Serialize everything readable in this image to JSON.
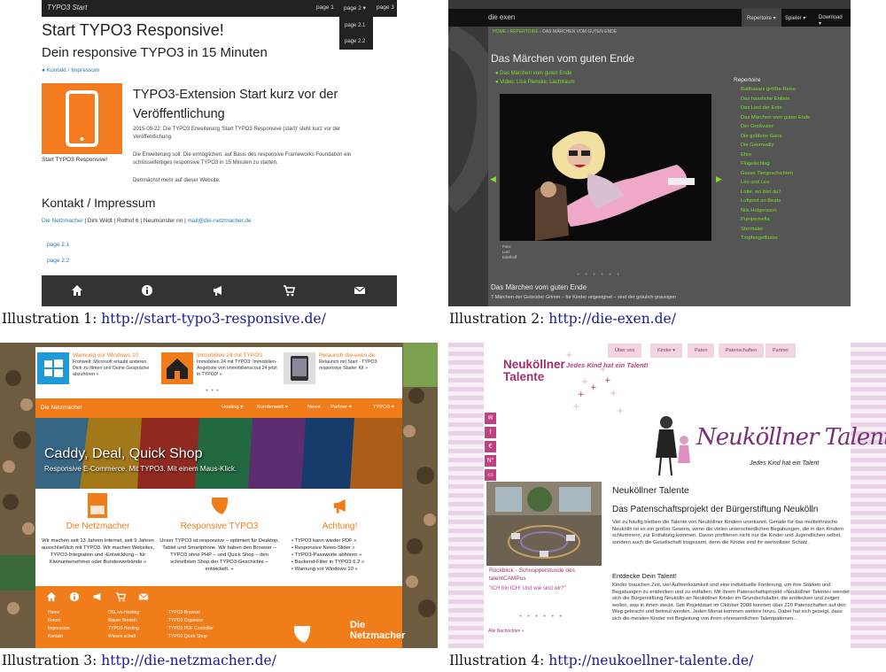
{
  "captions": [
    {
      "label": "Illustration 1: ",
      "url": "http://start-typo3-responsive.de/"
    },
    {
      "label": "Illustration 2: ",
      "url": "http://die-exen.de/"
    },
    {
      "label": "Illustration 3: ",
      "url": "http://die-netzmacher.de/"
    },
    {
      "label": "Illustration 4: ",
      "url": "http://neukoellner-talente.de/"
    }
  ],
  "site1": {
    "brand": "TYPO3 Start",
    "nav": [
      "page 1",
      "page 2 ▾",
      "page 3"
    ],
    "dropdown": [
      "page 2.1",
      "page 2.2"
    ],
    "title": "Start TYPO3 Responsive!",
    "subtitle": "Dein responsive TYPO3 in 15 Minuten",
    "link_contact": "● Kontakt / Impressum",
    "logo_caption": "Start TYPO3 Responsive!",
    "news_title": "TYPO3-Extension Start kurz vor der Veröffentlichung",
    "news_p1": "2015-09-22: Die TYPO3 Erweiterung 'Start TYPO3 Responsive (start)' steht kurz vor der Veröffentlichung.",
    "news_p2": "Die Erweiterung soll: Die ermöglichen, auf Basis des responsive Frameworks Foundation ein schlüsselfertiges responsive TYPO3 in 15 Minuten zu starten.",
    "news_p3": "Demnächst mehr auf dieser Website.",
    "contact_title": "Kontakt / Impressum",
    "contact_link1": "Die Netzmacher",
    "contact_text": " | Dirk Wildt | Rothof 6 | Neumünster nn | ",
    "contact_link2": "mail@die-netzmacher.de",
    "sublinks": [
      "page 2.1",
      "page 2.2"
    ],
    "footer_icons": [
      "home-icon",
      "info-icon",
      "megaphone-icon",
      "cart-icon",
      "mail-icon"
    ]
  },
  "site2": {
    "brand": "die exen",
    "menu": [
      "Repertoire ▾",
      "Spieler ▾",
      "Download ▾"
    ],
    "bread_home": "HOME",
    "bread_mid": "REPERTOIRE",
    "bread_current": "DAS MÄRCHEN VOM GUTEN ENDE",
    "title": "Das Märchen vom guten Ende",
    "links": [
      "● Das Märchen vom guten Ende",
      "● Video: Lisa Plenske, Lachtraum"
    ],
    "credit": [
      "Foto:",
      "Lutz",
      "Edelhoff"
    ],
    "sub_title": "Das Märchen vom guten Ende",
    "sub_text": "7 Märchen der Gebrüder Grimm – für Kinder ungeeignet – sind der gräulich grausigen",
    "repertoire_title": "Repertoire",
    "repertoire": [
      "Balthasars größte Reise",
      "Das hässliche Entlein",
      "Das Lied der Erde",
      "Das Märchen vom guten Ende",
      "Der Großvater",
      "Die goldene Gans",
      "Die Geierwally",
      "Ehre",
      "Flügelschlag",
      "Gasse Tiergeschichten",
      "Leo und Lea",
      "Lotte, wo bist du?",
      "Luftpost an Beate",
      "Nils Holgersson",
      "Pumpernella",
      "Sterntaler",
      "Tropfengeflüster"
    ]
  },
  "site3": {
    "teasers": [
      {
        "title": "Warnung vor Windows 10",
        "text": "Frohwelt: Microsoft erlaubt anderen, Dich zu filmen und Deine Gespräche abzuhören »"
      },
      {
        "title": "Immobilien 24 mit TYPO3",
        "text": "Immobilien 24 mit TYPO3: Immobilien-Angebote von immobilienscout 24 jetzt in TYPO3! »"
      },
      {
        "title": "Relaunch die-exen.de",
        "text": "Relaunch mit Start - TYPO3 responsive Starter Kit »"
      }
    ],
    "brand": "Die Netzmacher",
    "nav": [
      "Hosting ▾",
      "Kundenwelt ▾",
      "News",
      "Partner ▾",
      "TYPO3 ▾"
    ],
    "hero_title": "Caddy, Deal, Quick Shop",
    "hero_sub": "Responsive E-Commerce. Mit TYPO3. Mit einem Maus-Klick.",
    "columns": [
      {
        "title": "Die Netzmacher",
        "icon": "netzmacher-logo-icon",
        "text": "Wir machen seit 13 Jahren Internet, seit 9 Jahren ausschließlich mit TYPO3. Wir machen Websites, TYPO3-Integration und -Entwicklung – für Kleinunternehmer oder Bundesverbände »"
      },
      {
        "title": "Responsive TYPO3",
        "icon": "typo3-logo-icon",
        "text": "Unser TYPO3 ist responsive – optimiert für Desktop, Tablet und Smartphone. Wir haben den Browser – TYPO3 ohne PHP – und Quick Shop – den schnellsten Shop der TYPO3-Geschichte – entwickelt. »"
      },
      {
        "title": "Achtung!",
        "icon": "megaphone-icon",
        "list": [
          "• TYPO3 kann wieder PDF »",
          "• Responsive News-Slider »",
          "• TYPO3-Passworte abhören »",
          "• Backend-Filter in TYPO3 6.2 »",
          "• Warnung vor Windows 10 »"
        ]
      }
    ],
    "footer_links": [
      [
        "Home",
        "Forum",
        "Impressum",
        "Kontakt"
      ],
      [
        "DSL-vs-Hosting",
        "Blauer Bereich",
        "TYPO3 Hosting",
        "Wissen schaft"
      ],
      [
        "TYPO3 Browser",
        "TYPO3 Organizer",
        "TYPO3 PDF Controller",
        "TYPO3 Quick Shop"
      ]
    ],
    "footer_logo": "Die Netzmacher",
    "footer_icons": [
      "home-icon",
      "info-icon",
      "megaphone-icon",
      "cart-icon",
      "mail-icon"
    ]
  },
  "site4": {
    "nav": [
      "Über uns",
      "Kinder ▾",
      "Paten",
      "Patenschaften",
      "Partner"
    ],
    "logo_line1": "Neuköllner",
    "logo_line2": "Talente",
    "logo_tagline": "Jedes Kind hat ein Talent!",
    "big_title": "Neuköllner Talente",
    "big_sub": "Jedes Kind hat ein Talent",
    "side_icons": [
      "✉",
      "f",
      "€",
      "N°",
      "▭"
    ],
    "photo_cap1": "Rückblick - Schnupperstunde des",
    "photo_cap2": "talentCAMPus",
    "photo_cap3": "\"ICH bin ICH! Und wie sind wir?\"",
    "all_news": "Alle Nachrichten »",
    "h1": "Neuköllner Talente",
    "h2": "Das Patenschaftsprojekt der Bürgerstiftung Neukölln",
    "p1": "Viel zu häufig bleiben die Talente von Neuköllner Kindern unerkannt. Gerade für das multiethnische Neukölln ist es ein großer Gewinn, wenn die vielen unterschiedlichen Begabungen, die in den Kindern schlummern, zur Entfaltung kommen. Davon profitieren nicht nur die Kinder und Jugendlichen selbst, sondern auch die Gesellschaft insgesamt, denn die Kinder sind ihr wertvollster Schatz.",
    "h3": "Entdecke Dein Talent!",
    "p2": "Kinder brauchen Zeit, viel Aufmerksamkeit und eine individuelle Förderung, um ihre Stärken und Begabungen zu entdecken und zu entfalten. Mit ihrem Patenschaftsprojekt »Neuköllner Talente« wendet sich die Bürgerstiftung Neukölln an Neuköllner Kinder im Grundschulalter, die entdecken und zeigen wollen, was in ihnen steckt. Seit Projektstart im Oktober 2008 konnten über 220 Patenschaften auf den Weg gebracht und betreut werden. Jeden Monat kommen weitere hinzu. Dabei hat sich gezeigt, dass sich die meisten Kinder mit Begleitung von ihren ehrenamtlichen Talentpatinnen..."
  }
}
